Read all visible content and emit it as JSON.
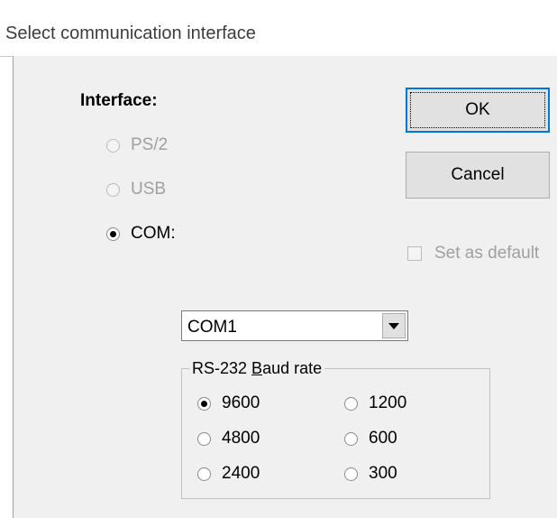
{
  "window": {
    "title": "Select communication interface"
  },
  "interface": {
    "label": "Interface:",
    "options": [
      {
        "label": "PS/2",
        "enabled": false,
        "checked": false
      },
      {
        "label": "USB",
        "enabled": false,
        "checked": false
      },
      {
        "label": "COM:",
        "enabled": true,
        "checked": true
      }
    ]
  },
  "buttons": {
    "ok_label": "OK",
    "cancel_label": "Cancel"
  },
  "default_checkbox": {
    "label": "Set as default",
    "enabled": false,
    "checked": false
  },
  "com_port": {
    "selected": "COM1"
  },
  "baud": {
    "legend_pre": "RS-232 ",
    "legend_accel": "B",
    "legend_post": "aud rate",
    "options": [
      {
        "label": "9600",
        "checked": true
      },
      {
        "label": "1200",
        "checked": false
      },
      {
        "label": "4800",
        "checked": false
      },
      {
        "label": "600",
        "checked": false
      },
      {
        "label": "2400",
        "checked": false
      },
      {
        "label": "300",
        "checked": false
      }
    ]
  }
}
